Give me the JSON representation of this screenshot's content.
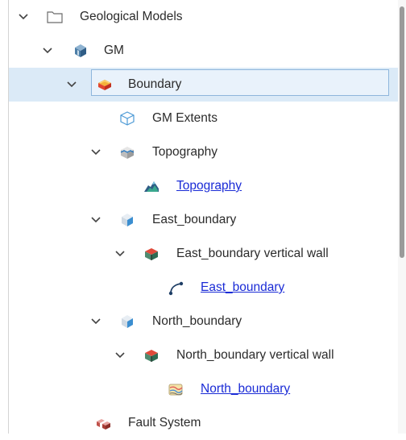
{
  "tree": {
    "items": [
      {
        "label": "Geological Models",
        "icon": "folder-icon"
      },
      {
        "label": "GM",
        "icon": "geological-model-icon"
      },
      {
        "label": "Boundary",
        "icon": "boundary-icon",
        "selected": true
      },
      {
        "label": "GM Extents",
        "icon": "extents-box-icon"
      },
      {
        "label": "Topography",
        "icon": "topography-folder-icon"
      },
      {
        "label": "Topography",
        "icon": "topography-surface-icon",
        "link": true
      },
      {
        "label": "East_boundary",
        "icon": "boundary-object-icon"
      },
      {
        "label": "East_boundary vertical wall",
        "icon": "vertical-wall-icon"
      },
      {
        "label": "East_boundary",
        "icon": "polyline-icon",
        "link": true
      },
      {
        "label": "North_boundary",
        "icon": "boundary-object-icon"
      },
      {
        "label": "North_boundary vertical wall",
        "icon": "vertical-wall-icon"
      },
      {
        "label": "North_boundary",
        "icon": "gis-data-icon",
        "link": true
      },
      {
        "label": "Fault System",
        "icon": "fault-system-icon"
      }
    ]
  },
  "colors": {
    "selection_bg": "#dbeaf7",
    "link": "#1a2bd6",
    "text": "#2b2b2b"
  }
}
